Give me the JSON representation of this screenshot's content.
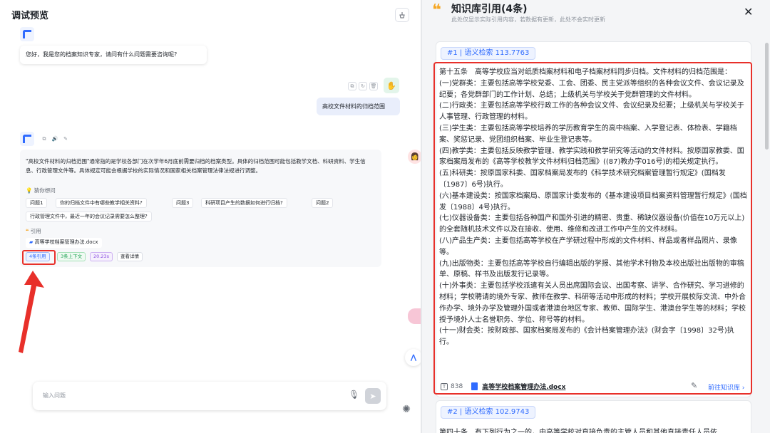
{
  "left_panel": {
    "title": "调试预览",
    "greeting": "您好，我是您的档案知识专家，请问有什么问题需要咨询呢?",
    "user_message": "高校文件材料的归档范围",
    "answer": "\"高校文件材料的归档范围\"通常指的是学校各部门在次学年6月底前需要归档的档案类型。具体的归档范围可能包括教学文档、科研资料、学生信息、行政管理文件等。具体规定可能会根据学校的实际情况和国家相关档案管理法律法规进行调整。",
    "suggest_title": "猜你想问",
    "suggestions": [
      "问题1",
      "你的归档文件中有哪些教学相关资料?",
      "问题3",
      "科研项目产生的数据如何进行归档?",
      "问题2",
      "行政管理文件中，最近一年的会议记录需要怎么整理?"
    ],
    "cite_title": "引用",
    "cite_file": "高等学校档案管理办法.docx",
    "tags": [
      "4条引用",
      "3条上下文",
      "20.23s",
      "查看详情"
    ],
    "input_placeholder": "输入问题"
  },
  "right_panel": {
    "title": "知识库引用(4条)",
    "subtitle": "此处仅显示实际引用内容，若数据有更新，此处不会实时更新",
    "card1_badge": "#1 | 语义检索 113.7763",
    "content": [
      "第十五条　高等学校应当对纸质档案材料和电子档案材料同步归档。文件材料的归档范围是：",
      "(一)党群类：主要包括高等学校党委、工会、团委、民主党派等组织的各种会议文件、会议记录及纪要；各党群部门的工作计划、总结；上级机关与学校关于党群管理的文件材料。",
      "(二)行政类：主要包括高等学校行政工作的各种会议文件、会议纪录及纪要；上级机关与学校关于人事管理、行政管理的材料。",
      "(三)学生类：主要包括高等学校培养的学历教育学生的高中档案、入学登记表、体检表、学籍档案、奖惩记录、党团组织档案、毕业生登记表等。",
      "(四)教学类：主要包括反映教学管理、教学实践和教学研究等活动的文件材料。按原国家教委、国家档案局发布的《高等学校教学文件材料归档范围》((87)教办字016号)的相关规定执行。",
      "(五)科研类：按原国家科委、国家档案局发布的《科学技术研究档案管理暂行规定》(国档发〔1987〕6号)执行。",
      "(六)基本建设类：按国家档案局、原国家计委发布的《基本建设项目档案资料管理暂行规定》(国档发〔1988〕4号)执行。",
      "(七)仪器设备类：主要包括各种国产和国外引进的精密、贵重、稀缺仪器设备(价值在10万元以上)的全套随机技术文件以及在接收、使用、维修和改进工作中产生的文件材料。",
      "(八)产品生产类：主要包括高等学校在产学研过程中形成的文件材料、样品或者样品照片、录像等。",
      "(九)出版物类：主要包括高等学校自行编辑出版的学报、其他学术刊物及本校出版社出版物的审稿单、原稿、样书及出版发行记录等。",
      "(十)外事类：主要包括学校派遣有关人员出席国际会议、出国考察、讲学、合作研究、学习进修的材料；学校聘请的境外专家、教师在教学、科研等活动中形成的材料；学校开展校际交流、中外合作办学、境外办学及管理外国或者港澳台地区专家、教师、国际学生、港澳台学生等的材料；学校授予境外人士名誉职务、学位、称号等的材料。",
      "(十一)财会类：按财政部、国家档案局发布的《会计档案管理办法》(财会字〔1998〕32号)执行。"
    ],
    "char_count": "838",
    "file_name": "高等学校档案管理办法.docx",
    "goto_label": "前往知识库",
    "card2_badge": "#2 | 语义检索 102.9743",
    "card2_text": "第四十条　有下列行为之一的，由高等学校对直接负责的主管人员和其他直接责任人员依"
  },
  "colors": {
    "accent": "#2f6bff",
    "highlight": "#e8302a",
    "quote": "#f5a623"
  }
}
